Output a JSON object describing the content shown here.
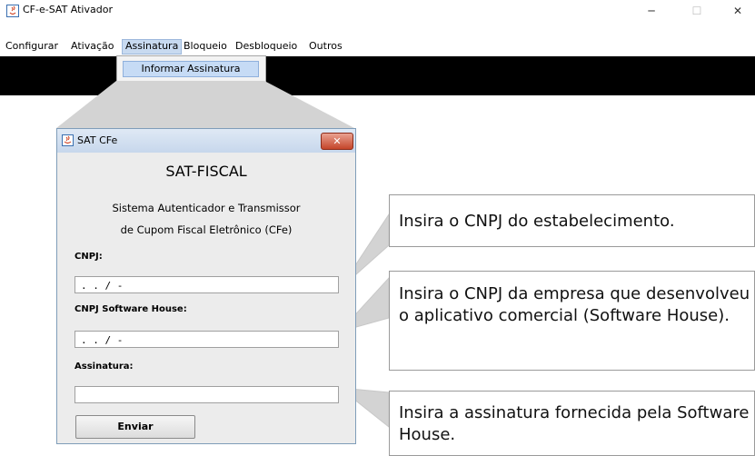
{
  "window": {
    "title": "CF-e-SAT Ativador",
    "controls": {
      "minimize": "─",
      "maximize": "☐",
      "close": "✕"
    }
  },
  "menubar": {
    "items": [
      "Configurar",
      "Ativação",
      "Assinatura",
      "Bloqueio",
      "Desbloqueio",
      "Outros"
    ],
    "active": "Assinatura"
  },
  "dropdown": {
    "item": "Informar Assinatura"
  },
  "dialog": {
    "title": "SAT CFe",
    "close": "✕",
    "heading": "SAT-FISCAL",
    "subtitle_line1": "Sistema Autenticador e Transmissor",
    "subtitle_line2": "de Cupom Fiscal Eletrônico (CFe)",
    "cnpj_label": "CNPJ:",
    "cnpj_value": " .  .  /  -",
    "sh_label": "CNPJ Software House:",
    "sh_value": " .  .  /  -",
    "assinatura_label": "Assinatura:",
    "assinatura_value": "",
    "send_button": "Enviar"
  },
  "callouts": {
    "cnpj": "Insira o CNPJ do estabelecimento.",
    "software_house": "Insira o CNPJ da empresa que desenvolveu o aplicativo comercial (Software House).",
    "assinatura": "Insira a assinatura fornecida pela Software House."
  },
  "colors": {
    "menu_highlight": "#c8daf0",
    "dark_panel": "#000000",
    "dialog_close": "#c5452a",
    "connector": "#c8c8c8"
  }
}
